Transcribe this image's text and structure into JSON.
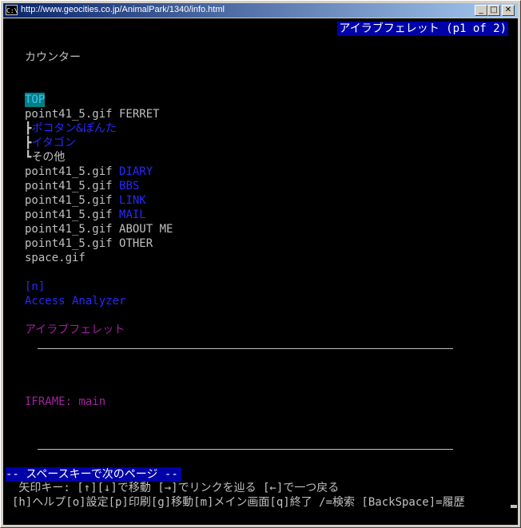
{
  "window": {
    "app_icon": "C:\\",
    "title": "http://www.geocities.co.jp/AnimalPark/1340/info.html",
    "buttons": {
      "minimize": "_",
      "maximize": "□",
      "close": "✕"
    }
  },
  "page_indicator": "アイラブフェレット (p1 of 2)",
  "content": {
    "counter": "カウンター",
    "top_link": "TOP",
    "ferret_prefix": "point41_5.gif FERRET",
    "sub_items": [
      {
        "branch": "┣",
        "label": "ポコタン&ぽんた"
      },
      {
        "branch": "┣",
        "label": "イタゴン"
      },
      {
        "branch": "┗",
        "label": "その他"
      }
    ],
    "nav_prefix": "point41_5.gif ",
    "nav_items": [
      {
        "label": "DIARY"
      },
      {
        "label": "BBS"
      },
      {
        "label": "LINK"
      },
      {
        "label": "MAIL"
      },
      {
        "label": "ABOUT ME"
      },
      {
        "label": "OTHER"
      }
    ],
    "space_gif": "space.gif",
    "n_link": "[n]",
    "access_analyzer": "Access Analyzer",
    "site_name": "アイラブフェレット",
    "iframe_label": "IFRAME: main"
  },
  "status_bar": "-- スペースキーで次のページ --",
  "help_line1": " 矢印キー: [↑][↓]で移動 [→]でリンクを辿る [←]で一つ戻る",
  "help_line2": "[h]ヘルプ[o]設定[p]印刷[g]移動[m]メイン画面[q]終了 /=検索 [BackSpace]=履歴"
}
